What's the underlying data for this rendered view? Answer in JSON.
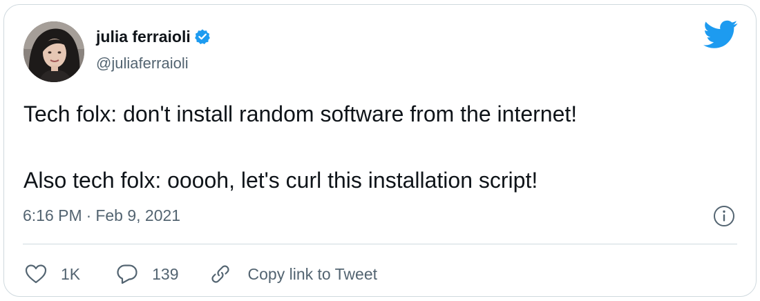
{
  "author": {
    "name": "julia ferraioli",
    "handle": "@juliaferraioli",
    "verified": true
  },
  "tweet": {
    "lines": [
      "Tech folx: don't install random software from the internet!",
      "",
      "Also tech folx: ooooh, let's curl this installation script!"
    ],
    "time": "6:16 PM",
    "separator": "·",
    "date": "Feb 9, 2021"
  },
  "actions": {
    "like_count": "1K",
    "reply_count": "139",
    "copy_label": "Copy link to Tweet"
  },
  "icons": {
    "brand": "twitter-bird-icon",
    "verified": "verified-badge-icon",
    "info": "info-icon",
    "like": "heart-icon",
    "reply": "reply-bubble-icon",
    "copy": "link-icon"
  },
  "colors": {
    "brand_blue": "#1d9bf0",
    "text_primary": "#0f1419",
    "text_secondary": "#536471",
    "border": "#cfd9de"
  }
}
